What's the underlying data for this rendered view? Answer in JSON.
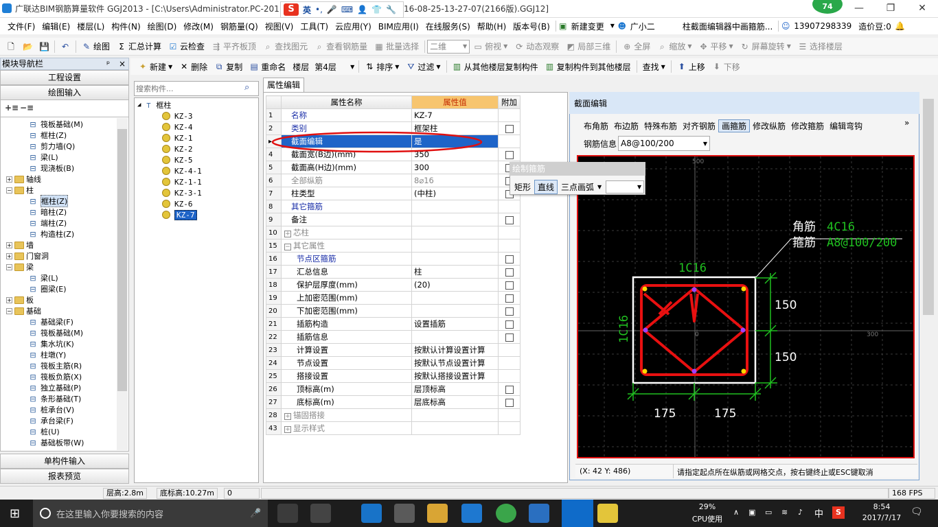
{
  "window": {
    "title": "广联达BIM钢筋算量软件 GGJ2013 - [C:\\Users\\Administrator.PC-201",
    "title_suffix": "16-08-25-13-27-07(2166版).GGJ12]",
    "ime_label": "英",
    "badge_number": "74"
  },
  "menu": [
    "文件(F)",
    "编辑(E)",
    "楼层(L)",
    "构件(N)",
    "绘图(D)",
    "修改(M)",
    "钢筋量(Q)",
    "视图(V)",
    "工具(T)",
    "云应用(Y)",
    "BIM应用(I)",
    "在线服务(S)",
    "帮助(H)",
    "版本号(B)",
    "新建变更",
    "广小二",
    "柱截面编辑器中画箍筋...",
    "13907298339",
    "造价豆:0"
  ],
  "toolbar1": {
    "draw": "绘图",
    "sum_calc": "汇总计算",
    "cloud_check": "云检查",
    "level_slab": "平齐板顶",
    "find_element": "查找图元",
    "view_rebar": "查看钢筋量",
    "batch_select": "批量选择",
    "view_mode": "二维",
    "top_view": "俯视",
    "dynamic_view": "动态观察",
    "local_3d": "局部三维",
    "fullscreen": "全屏",
    "zoom": "缩放",
    "pan": "平移",
    "screen_rotate": "屏幕旋转",
    "select_floor": "选择楼层"
  },
  "toolbar2": {
    "new": "新建",
    "delete": "删除",
    "copy": "复制",
    "rename": "重命名",
    "floor_label": "楼层",
    "floor_value": "第4层",
    "sort": "排序",
    "filter": "过滤",
    "copy_from": "从其他楼层复制构件",
    "copy_to": "复制构件到其他楼层",
    "find": "查找",
    "move_up": "上移",
    "move_down": "下移"
  },
  "nav": {
    "title": "模块导航栏",
    "pin": "ª ×",
    "top_buttons": [
      "工程设置",
      "绘图输入"
    ],
    "bottom_buttons": [
      "单构件输入",
      "报表预览"
    ],
    "tree": [
      {
        "label": "筏板基础(M)",
        "level": 2,
        "type": "item"
      },
      {
        "label": "框柱(Z)",
        "level": 2,
        "type": "item"
      },
      {
        "label": "剪力墙(Q)",
        "level": 2,
        "type": "item"
      },
      {
        "label": "梁(L)",
        "level": 2,
        "type": "item"
      },
      {
        "label": "现浇板(B)",
        "level": 2,
        "type": "item"
      },
      {
        "label": "轴线",
        "level": 1,
        "type": "folder",
        "exp": "+"
      },
      {
        "label": "柱",
        "level": 1,
        "type": "folder",
        "exp": "−"
      },
      {
        "label": "框柱(Z)",
        "level": 2,
        "type": "item",
        "selected": true
      },
      {
        "label": "暗柱(Z)",
        "level": 2,
        "type": "item"
      },
      {
        "label": "端柱(Z)",
        "level": 2,
        "type": "item"
      },
      {
        "label": "构造柱(Z)",
        "level": 2,
        "type": "item"
      },
      {
        "label": "墙",
        "level": 1,
        "type": "folder",
        "exp": "+"
      },
      {
        "label": "门窗洞",
        "level": 1,
        "type": "folder",
        "exp": "+"
      },
      {
        "label": "梁",
        "level": 1,
        "type": "folder",
        "exp": "−"
      },
      {
        "label": "梁(L)",
        "level": 2,
        "type": "item"
      },
      {
        "label": "圈梁(E)",
        "level": 2,
        "type": "item"
      },
      {
        "label": "板",
        "level": 1,
        "type": "folder",
        "exp": "+"
      },
      {
        "label": "基础",
        "level": 1,
        "type": "folder",
        "exp": "−"
      },
      {
        "label": "基础梁(F)",
        "level": 2,
        "type": "item"
      },
      {
        "label": "筏板基础(M)",
        "level": 2,
        "type": "item"
      },
      {
        "label": "集水坑(K)",
        "level": 2,
        "type": "item"
      },
      {
        "label": "柱墩(Y)",
        "level": 2,
        "type": "item"
      },
      {
        "label": "筏板主筋(R)",
        "level": 2,
        "type": "item"
      },
      {
        "label": "筏板负筋(X)",
        "level": 2,
        "type": "item"
      },
      {
        "label": "独立基础(P)",
        "level": 2,
        "type": "item"
      },
      {
        "label": "条形基础(T)",
        "level": 2,
        "type": "item"
      },
      {
        "label": "桩承台(V)",
        "level": 2,
        "type": "item"
      },
      {
        "label": "承台梁(F)",
        "level": 2,
        "type": "item"
      },
      {
        "label": "桩(U)",
        "level": 2,
        "type": "item"
      },
      {
        "label": "基础板带(W)",
        "level": 2,
        "type": "item"
      }
    ]
  },
  "component_tree": {
    "search_placeholder": "搜索构件...",
    "root": "框柱",
    "items": [
      "KZ-3",
      "KZ-4",
      "KZ-1",
      "KZ-2",
      "KZ-5",
      "KZ-4-1",
      "KZ-1-1",
      "KZ-3-1",
      "KZ-6",
      "KZ-7"
    ],
    "selected": "KZ-7"
  },
  "property_editor": {
    "tab": "属性编辑",
    "header": {
      "name": "属性名称",
      "value": "属性值",
      "extra": "附加"
    },
    "rows": [
      {
        "num": "1",
        "name": "名称",
        "value": "KZ-7",
        "style": "blue",
        "check": false
      },
      {
        "num": "2",
        "name": "类别",
        "value": "框架柱",
        "style": "blue",
        "check": true
      },
      {
        "num": "3",
        "name": "截面编辑",
        "value": "是",
        "style": "sel",
        "check": false
      },
      {
        "num": "4",
        "name": "截面宽(B边)(mm)",
        "value": "350",
        "style": "",
        "check": true
      },
      {
        "num": "5",
        "name": "截面高(H边)(mm)",
        "value": "300",
        "style": "",
        "check": true
      },
      {
        "num": "6",
        "name": "全部纵筋",
        "value": "8⌀16",
        "style": "gray",
        "check": true
      },
      {
        "num": "7",
        "name": "柱类型",
        "value": "(中柱)",
        "style": "",
        "check": true
      },
      {
        "num": "8",
        "name": "其它箍筋",
        "value": "",
        "style": "blue",
        "check": false
      },
      {
        "num": "9",
        "name": "备注",
        "value": "",
        "style": "",
        "check": true
      },
      {
        "num": "10",
        "name": "芯柱",
        "value": "",
        "style": "gray",
        "check": false,
        "expander": "+"
      },
      {
        "num": "15",
        "name": "其它属性",
        "value": "",
        "style": "gray",
        "check": false,
        "expander": "−"
      },
      {
        "num": "16",
        "name": "节点区箍筋",
        "value": "",
        "style": "blue ind",
        "check": true
      },
      {
        "num": "17",
        "name": "汇总信息",
        "value": "柱",
        "style": "ind",
        "check": true
      },
      {
        "num": "18",
        "name": "保护层厚度(mm)",
        "value": "(20)",
        "style": "ind",
        "check": true
      },
      {
        "num": "19",
        "name": "上加密范围(mm)",
        "value": "",
        "style": "ind",
        "check": true
      },
      {
        "num": "20",
        "name": "下加密范围(mm)",
        "value": "",
        "style": "ind",
        "check": true
      },
      {
        "num": "21",
        "name": "插筋构造",
        "value": "设置插筋",
        "style": "ind",
        "check": true
      },
      {
        "num": "22",
        "name": "插筋信息",
        "value": "",
        "style": "ind",
        "check": true
      },
      {
        "num": "23",
        "name": "计算设置",
        "value": "按默认计算设置计算",
        "style": "ind",
        "check": false
      },
      {
        "num": "24",
        "name": "节点设置",
        "value": "按默认节点设置计算",
        "style": "ind",
        "check": false
      },
      {
        "num": "25",
        "name": "搭接设置",
        "value": "按默认搭接设置计算",
        "style": "ind",
        "check": false
      },
      {
        "num": "26",
        "name": "顶标高(m)",
        "value": "层顶标高",
        "style": "ind",
        "check": true
      },
      {
        "num": "27",
        "name": "底标高(m)",
        "value": "层底标高",
        "style": "ind",
        "check": true
      },
      {
        "num": "28",
        "name": "锚固搭接",
        "value": "",
        "style": "gray",
        "check": false,
        "expander": "+"
      },
      {
        "num": "43",
        "name": "显示样式",
        "value": "",
        "style": "gray",
        "check": false,
        "expander": "+"
      }
    ]
  },
  "section_editor": {
    "title": "截面编辑",
    "tabs": [
      "布角筋",
      "布边筋",
      "特殊布筋",
      "对齐钢筋",
      "画箍筋",
      "修改纵筋",
      "修改箍筋",
      "编辑弯钩"
    ],
    "active_tab": "画箍筋",
    "rebar_info_label": "钢筋信息",
    "rebar_info_value": "A8@100/200",
    "canvas": {
      "corner_label": "角筋",
      "corner_value": "4C16",
      "stirrup_label": "箍筋",
      "stirrup_value": "A8@100/200",
      "top_bar": "1C16",
      "left_bar": "1C16",
      "dim_right_top": "150",
      "dim_right_bottom": "150",
      "dim_bottom_left": "175",
      "dim_bottom_right": "175",
      "grid_label_top": "500",
      "grid_label_right": "300",
      "grid_label_center": "0"
    },
    "coords": "(X: 42 Y: 486)",
    "hint": "请指定起点所在纵筋或网格交点，按右键终止或ESC键取消"
  },
  "popup": {
    "title": "绘制箍筋",
    "options": [
      "矩形",
      "直线",
      "三点画弧"
    ],
    "active": "直线"
  },
  "status": {
    "floor_height": "层高:2.8m",
    "base_elev": "底标高:10.27m",
    "zero": "0",
    "fps": "168 FPS"
  },
  "taskbar": {
    "search_placeholder": "在这里输入你要搜索的内容",
    "cpu_percent": "29%",
    "cpu_label": "CPU使用",
    "lang": "中",
    "time": "8:54",
    "date": "2017/7/17"
  },
  "colors": {
    "rebar_red": "#e81010",
    "dim_green": "#20c020",
    "canvas_bg": "#000000",
    "selection_blue": "#1e64c8",
    "highlight_orange": "#f7c56f"
  }
}
